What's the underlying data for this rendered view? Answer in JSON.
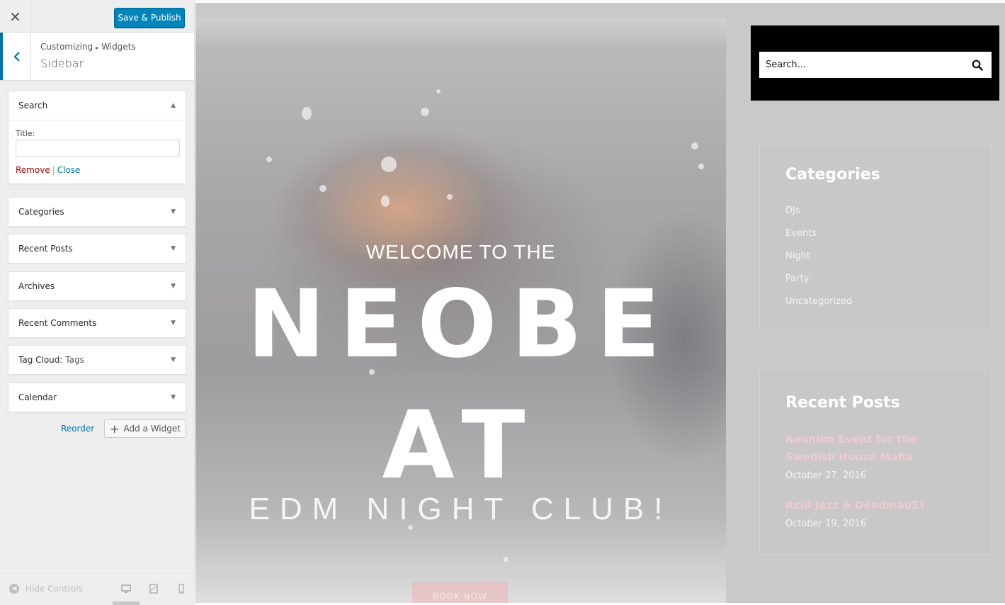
{
  "header": {
    "close_icon": "×",
    "save_label": "Save & Publish"
  },
  "section": {
    "breadcrumb_root": "Customizing",
    "breadcrumb_sep": "▸",
    "breadcrumb_leaf": "Widgets",
    "title": "Sidebar"
  },
  "widgets": [
    {
      "label": "Search",
      "expanded": true
    },
    {
      "label": "Categories"
    },
    {
      "label": "Recent Posts"
    },
    {
      "label": "Archives"
    },
    {
      "label": "Recent Comments"
    },
    {
      "label": "Tag Cloud:",
      "sub": "Tags"
    },
    {
      "label": "Calendar"
    }
  ],
  "search_widget": {
    "title_label": "Title:",
    "title_value": "",
    "remove": "Remove",
    "pipe": "|",
    "close": "Close"
  },
  "actions": {
    "reorder": "Reorder",
    "add_widget": "Add a Widget"
  },
  "footer": {
    "hide_controls": "Hide Controls"
  },
  "preview": {
    "welcome": "WELCOME TO THE",
    "line1": "NEOBE",
    "line2": "AT",
    "tagline": "EDM NIGHT CLUB!",
    "book": "BOOK NOW",
    "search_placeholder": "Search...",
    "categories_title": "Categories",
    "categories": [
      "DJs",
      "Events",
      "Night",
      "Party",
      "Uncategorized"
    ],
    "recent_title": "Recent Posts",
    "posts": [
      {
        "title": "Reunion Event for the Swedish House Mafia",
        "date": "October 27, 2016"
      },
      {
        "title": "Acid Jazz & Deadmau5?",
        "date": "October 19, 2016"
      }
    ]
  },
  "colors": {
    "wp_blue": "#0085ba",
    "link": "#0073aa",
    "remove": "#aa0000",
    "post_link": "#f2c9cc"
  }
}
